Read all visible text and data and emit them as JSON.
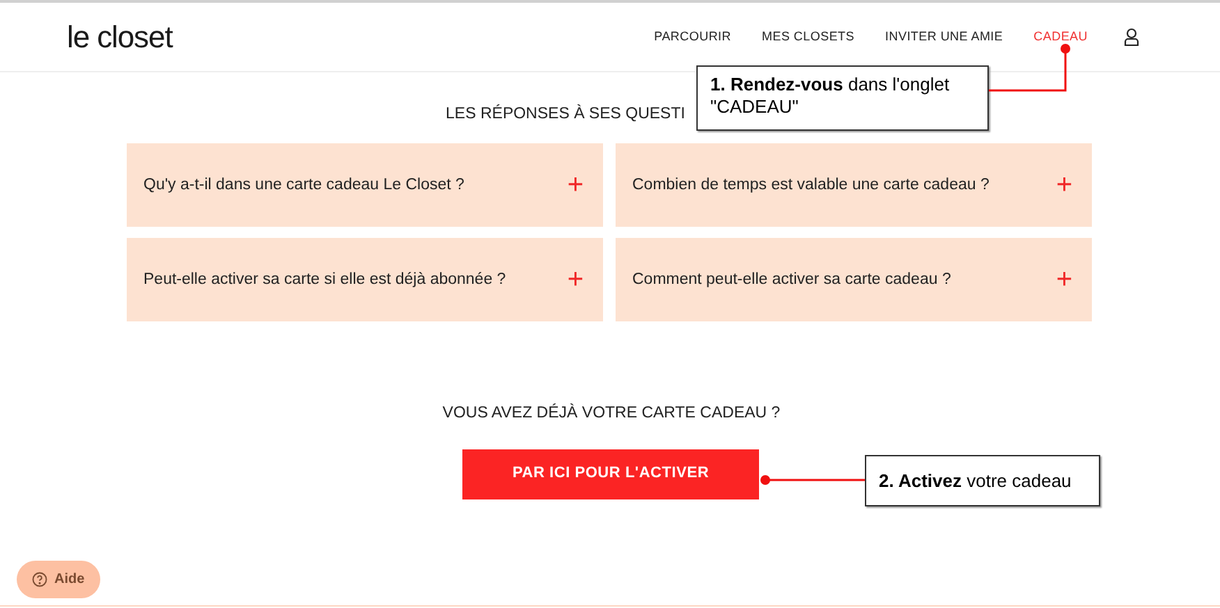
{
  "header": {
    "logo": "le closet",
    "nav": [
      {
        "label": "PARCOURIR",
        "selected": false
      },
      {
        "label": "MES CLOSETS",
        "selected": false
      },
      {
        "label": "INVITER UNE AMIE",
        "selected": false
      },
      {
        "label": "CADEAU",
        "selected": true
      }
    ]
  },
  "faq": {
    "heading": "LES RÉPONSES À SES QUESTI",
    "questions": [
      {
        "text": "Qu'y a-t-il dans une carte cadeau Le Closet ?",
        "icon": "+"
      },
      {
        "text": "Combien de temps est valable une carte cadeau ?",
        "icon": "+"
      },
      {
        "text": "Peut-elle activer sa carte si elle est déjà abonnée ?",
        "icon": "+"
      },
      {
        "text": "Comment peut-elle activer sa carte cadeau ?",
        "icon": "+"
      }
    ]
  },
  "activate": {
    "heading": "VOUS AVEZ DÉJÀ VOTRE CARTE CADEAU ?",
    "button": "PAR ICI POUR L'ACTIVER"
  },
  "help_button": "Aide",
  "annotations": [
    "**1. Rendez-vous** dans l'onglet \"CADEAU\"",
    "**2. Activez** votre cadeau"
  ]
}
